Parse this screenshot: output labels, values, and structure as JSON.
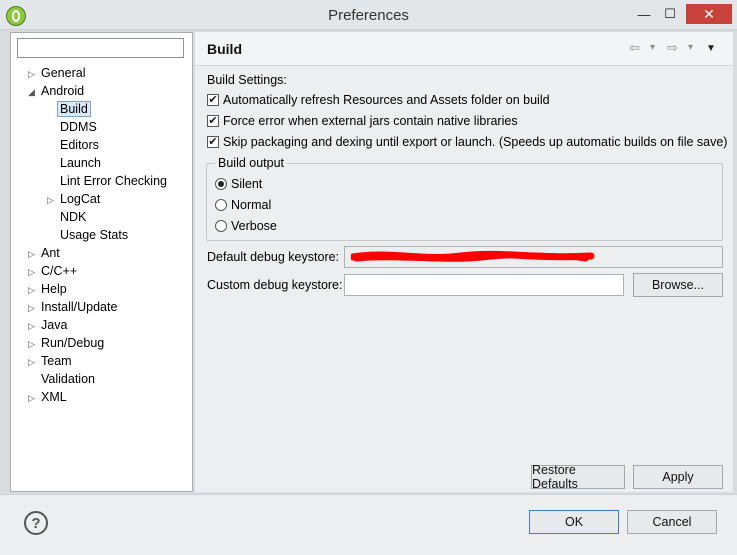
{
  "window": {
    "title": "Preferences",
    "min_glyph": "—",
    "max_glyph": "☐",
    "close_glyph": "✕"
  },
  "tree": {
    "filter_value": "",
    "items": [
      {
        "label": "General",
        "level": 0,
        "arrow": "▷"
      },
      {
        "label": "Android",
        "level": 0,
        "arrow": "◢"
      },
      {
        "label": "Build",
        "level": 1,
        "arrow": "",
        "selected": true
      },
      {
        "label": "DDMS",
        "level": 1,
        "arrow": ""
      },
      {
        "label": "Editors",
        "level": 1,
        "arrow": ""
      },
      {
        "label": "Launch",
        "level": 1,
        "arrow": ""
      },
      {
        "label": "Lint Error Checking",
        "level": 1,
        "arrow": ""
      },
      {
        "label": "LogCat",
        "level": 1,
        "arrow": "▷"
      },
      {
        "label": "NDK",
        "level": 1,
        "arrow": ""
      },
      {
        "label": "Usage Stats",
        "level": 1,
        "arrow": ""
      },
      {
        "label": "Ant",
        "level": 0,
        "arrow": "▷"
      },
      {
        "label": "C/C++",
        "level": 0,
        "arrow": "▷"
      },
      {
        "label": "Help",
        "level": 0,
        "arrow": "▷"
      },
      {
        "label": "Install/Update",
        "level": 0,
        "arrow": "▷"
      },
      {
        "label": "Java",
        "level": 0,
        "arrow": "▷"
      },
      {
        "label": "Run/Debug",
        "level": 0,
        "arrow": "▷"
      },
      {
        "label": "Team",
        "level": 0,
        "arrow": "▷"
      },
      {
        "label": "Validation",
        "level": 0,
        "arrow": ""
      },
      {
        "label": "XML",
        "level": 0,
        "arrow": "▷"
      }
    ]
  },
  "page": {
    "title": "Build",
    "nav": {
      "back": "⇦",
      "forward": "⇨",
      "dropdown": "▾",
      "menu": "▼"
    },
    "build_settings_label": "Build Settings:",
    "checkboxes": [
      {
        "label": "Automatically refresh Resources and Assets folder on build",
        "checked": true
      },
      {
        "label": "Force error when external jars contain native libraries",
        "checked": true
      },
      {
        "label": "Skip packaging and dexing until export or launch. (Speeds up automatic builds on file save)",
        "checked": true
      }
    ],
    "check_glyph": "✔",
    "build_output": {
      "title": "Build output",
      "options": [
        {
          "label": "Silent",
          "selected": true
        },
        {
          "label": "Normal",
          "selected": false
        },
        {
          "label": "Verbose",
          "selected": false
        }
      ]
    },
    "default_keystore_label": "Default debug keystore:",
    "custom_keystore_label": "Custom debug keystore:",
    "custom_keystore_value": "",
    "browse_label": "Browse...",
    "restore_defaults_label": "Restore Defaults",
    "apply_label": "Apply"
  },
  "footer": {
    "help_glyph": "?",
    "ok_label": "OK",
    "cancel_label": "Cancel"
  },
  "colors": {
    "selection_bg": "#dbe8f6",
    "redaction": "#ff0000",
    "close_button": "#c7423a"
  }
}
